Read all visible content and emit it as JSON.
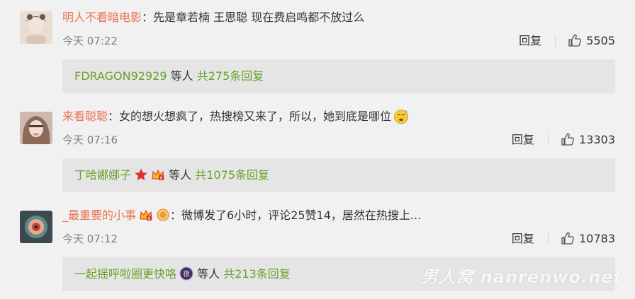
{
  "comments": [
    {
      "user": "明人不看暗电影",
      "text": "：先是章若楠 王思聪 现在费启鸣都不放过么",
      "time": "今天 07:22",
      "reply_label": "回复",
      "likes": "5505",
      "replies": {
        "names": "FDRAGON92929",
        "mid": " 等人 ",
        "total": "共275条回复"
      }
    },
    {
      "user": "来看聪聪",
      "text": "：女的想火想疯了，热搜榜又来了，所以，她到底是哪位",
      "time": "今天 07:16",
      "reply_label": "回复",
      "likes": "13303",
      "replies": {
        "names": "丁哈娜娜子",
        "mid": " 等人 ",
        "total": "共1075条回复"
      }
    },
    {
      "user": "_最重要的小事",
      "text": "：微博发了6小时，评论25赞14，居然在热搜上...",
      "time": "今天 07:12",
      "reply_label": "回复",
      "likes": "10783",
      "replies": {
        "names": "一起摇呼啦圈更快咯",
        "mid": " 等人 ",
        "total": "共213条回复"
      }
    }
  ],
  "watermark": "男人窝 nanrenwo.net",
  "colors": {
    "username": "#eb7350",
    "reply_link": "#6aa22a",
    "background": "#f1f1f1",
    "reply_box": "#e5e5e5"
  }
}
